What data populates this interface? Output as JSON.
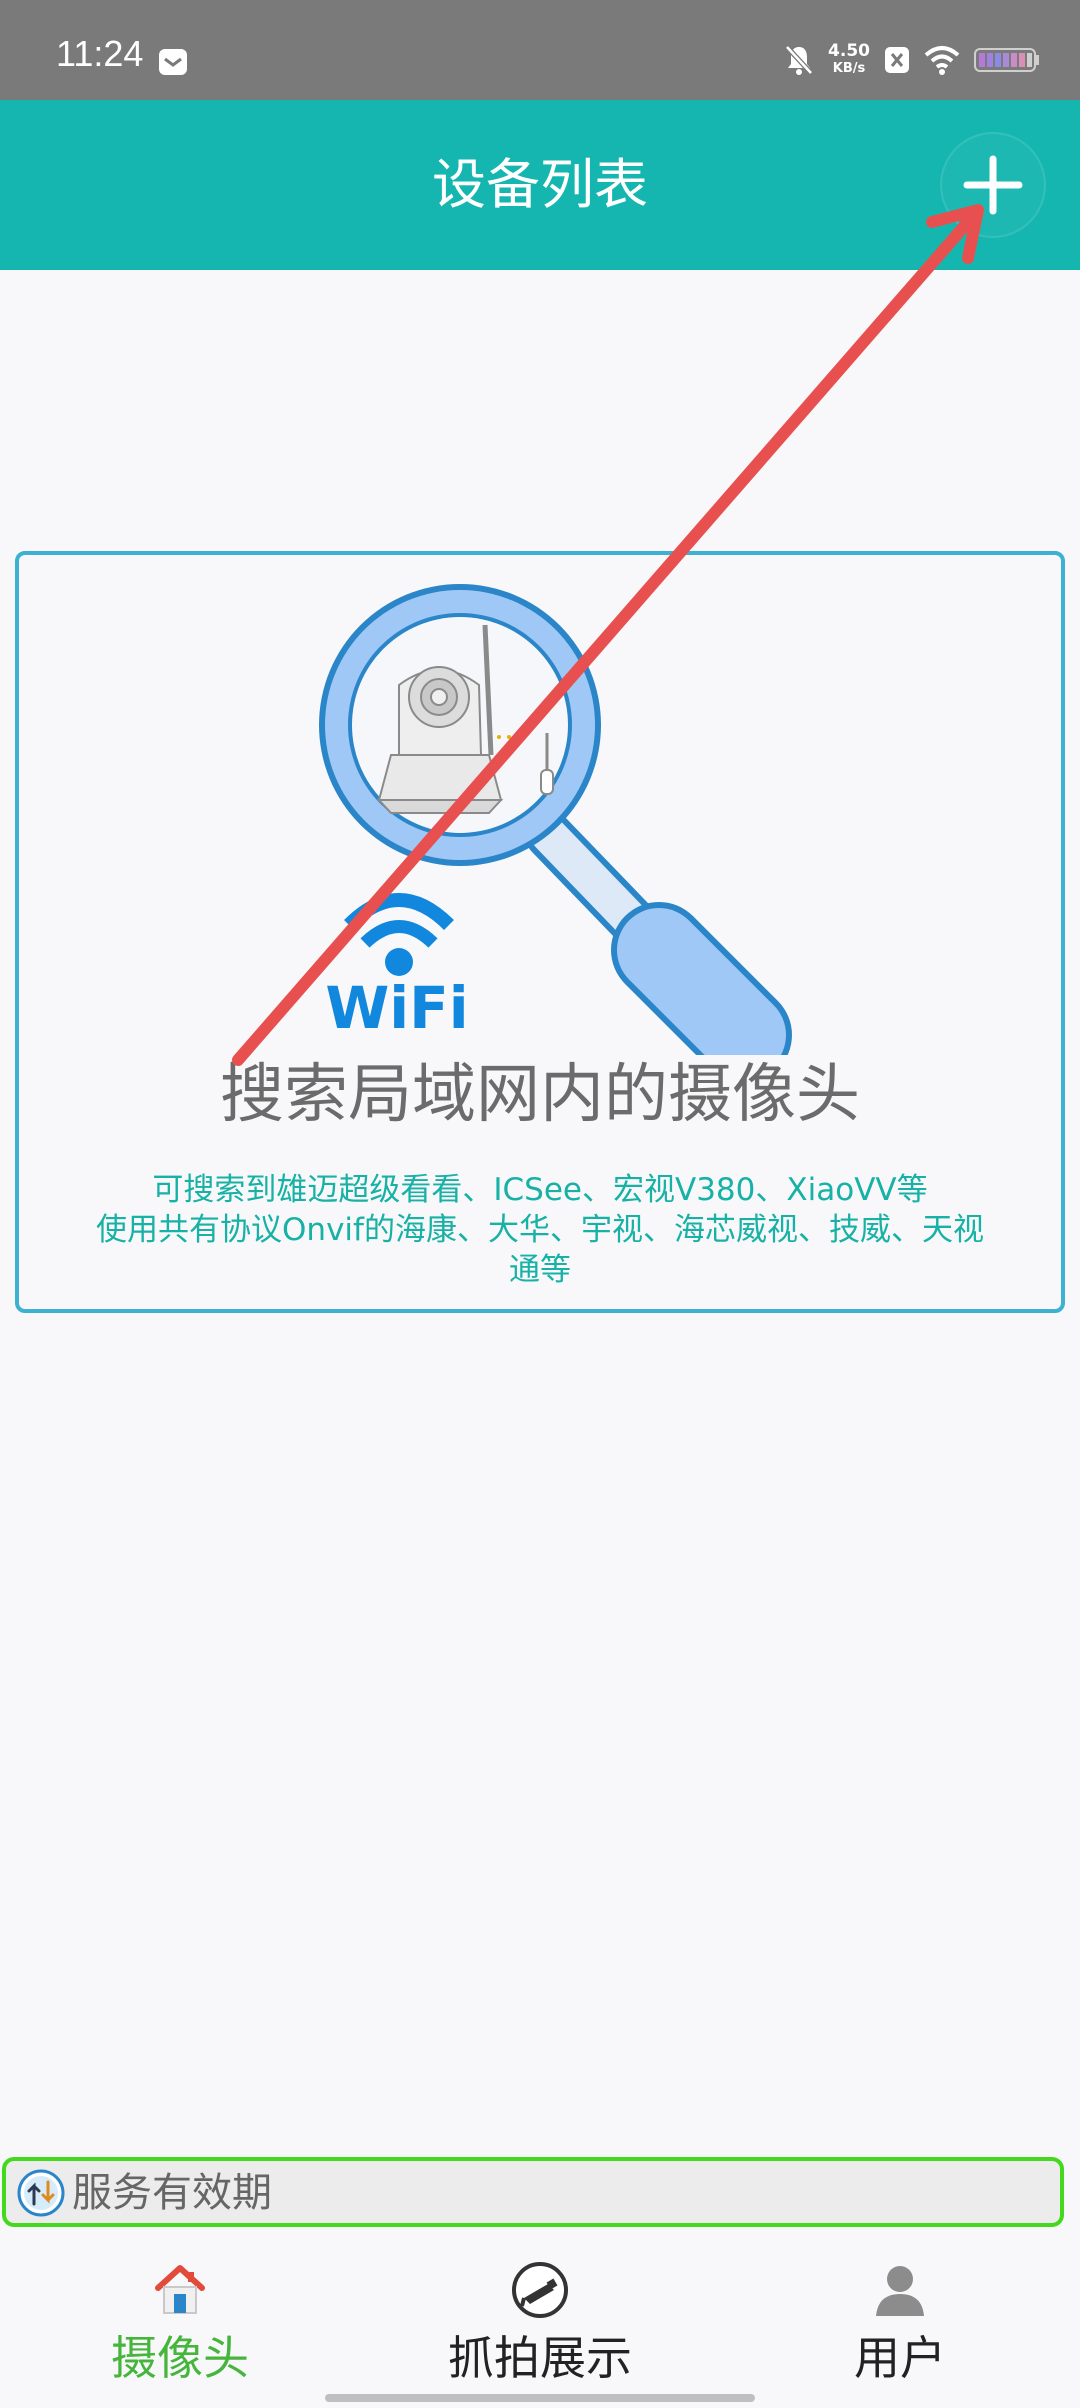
{
  "status_bar": {
    "time": "11:24",
    "net_speed_value": "4.50",
    "net_speed_unit": "KB/s"
  },
  "header": {
    "title": "设备列表",
    "add_label": "+"
  },
  "search_card": {
    "wifi_text": "WiFi",
    "title": "搜索局域网内的摄像头",
    "desc_line1": "可搜索到雄迈超级看看、ICSee、宏视V380、XiaoVV等",
    "desc_line2": "使用共有协议Onvif的海康、大华、宇视、海芯威视、技威、天视",
    "desc_line3": "通等"
  },
  "service": {
    "label": "服务有效期"
  },
  "bottom_nav": {
    "items": [
      {
        "label": "摄像头",
        "icon": "home-icon",
        "active": true
      },
      {
        "label": "抓拍展示",
        "icon": "camera-icon",
        "active": false
      },
      {
        "label": "用户",
        "icon": "user-icon",
        "active": false
      }
    ]
  },
  "colors": {
    "accent": "#15b6b0",
    "card_border": "#3cb1d2",
    "desc_text": "#17b1a6",
    "nav_active": "#46b53c",
    "service_border": "#44d81f",
    "arrow": "#e85050"
  }
}
